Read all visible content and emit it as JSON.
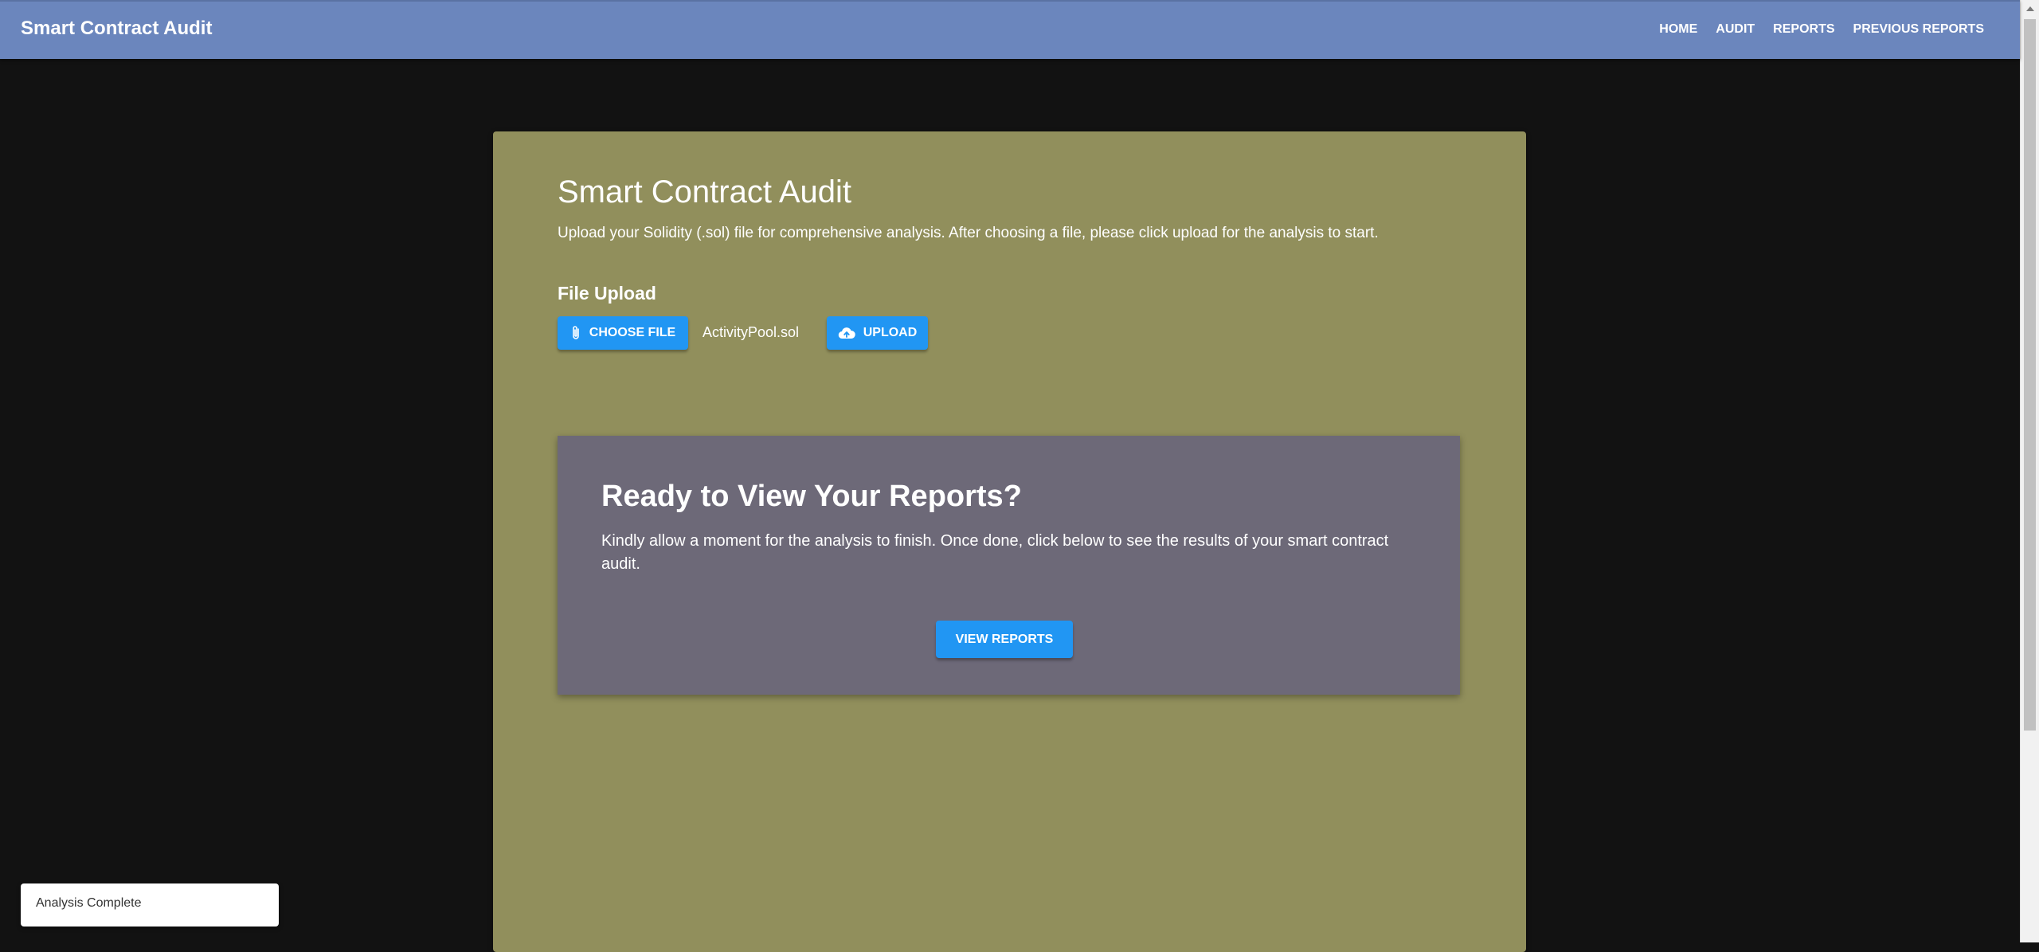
{
  "appbar": {
    "title": "Smart Contract Audit",
    "nav": [
      {
        "label": "HOME"
      },
      {
        "label": "AUDIT"
      },
      {
        "label": "REPORTS"
      },
      {
        "label": "PREVIOUS REPORTS"
      }
    ]
  },
  "main": {
    "title": "Smart Contract Audit",
    "intro": "Upload your Solidity (.sol) file for comprehensive analysis. After choosing a file, please click upload for the analysis to start.",
    "upload_heading": "File Upload",
    "choose_file_label": "CHOOSE FILE",
    "choose_file_icon": "paperclip-icon",
    "selected_file": "ActivityPool.sol",
    "upload_label": "UPLOAD",
    "upload_icon": "cloud-upload-icon"
  },
  "reports_panel": {
    "heading": "Ready to View Your Reports?",
    "text": "Kindly allow a moment for the analysis to finish. Once done, click below to see the results of your smart contract audit.",
    "button_label": "VIEW REPORTS"
  },
  "toast": {
    "message": "Analysis Complete"
  },
  "colors": {
    "appbar": "#6b86bd",
    "background": "#121212",
    "card": "#918f5c",
    "panel": "#6d6978",
    "primary_button": "#2196f3"
  }
}
